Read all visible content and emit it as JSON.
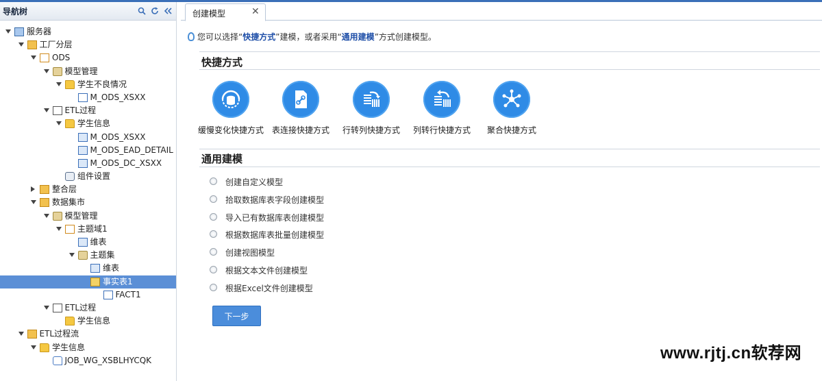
{
  "sidebar": {
    "title": "导航树",
    "tools": [
      "search-icon",
      "refresh-icon",
      "collapse-icon"
    ],
    "tree": [
      {
        "label": "服务器",
        "level": 0,
        "expand": "down",
        "icon": "server-icon"
      },
      {
        "label": "工厂分层",
        "level": 1,
        "expand": "down",
        "icon": "layer-icon"
      },
      {
        "label": "ODS",
        "level": 2,
        "expand": "down",
        "icon": "ods-icon"
      },
      {
        "label": "模型管理",
        "level": 3,
        "expand": "down",
        "icon": "model-manage-icon"
      },
      {
        "label": "学生不良情况",
        "level": 4,
        "expand": "down",
        "icon": "folder-icon"
      },
      {
        "label": "M_ODS_XSXX",
        "level": 5,
        "expand": "",
        "icon": "table-icon"
      },
      {
        "label": "ETL过程",
        "level": 3,
        "expand": "down",
        "icon": "etl-icon"
      },
      {
        "label": "学生信息",
        "level": 4,
        "expand": "down",
        "icon": "folder-icon"
      },
      {
        "label": "M_ODS_XSXX",
        "level": 5,
        "expand": "",
        "icon": "mapping-icon"
      },
      {
        "label": "M_ODS_EAD_DETAIL",
        "level": 5,
        "expand": "",
        "icon": "mapping-icon"
      },
      {
        "label": "M_ODS_DC_XSXX",
        "level": 5,
        "expand": "",
        "icon": "mapping-icon"
      },
      {
        "label": "组件设置",
        "level": 4,
        "expand": "",
        "icon": "component-settings-icon"
      },
      {
        "label": "整合层",
        "level": 2,
        "expand": "right",
        "icon": "layer-icon"
      },
      {
        "label": "数据集市",
        "level": 2,
        "expand": "down",
        "icon": "datamart-icon"
      },
      {
        "label": "模型管理",
        "level": 3,
        "expand": "down",
        "icon": "model-manage-icon"
      },
      {
        "label": "主题域1",
        "level": 4,
        "expand": "down",
        "icon": "subject-domain-icon"
      },
      {
        "label": "维表",
        "level": 5,
        "expand": "",
        "icon": "dimension-icon"
      },
      {
        "label": "主题集",
        "level": 5,
        "expand": "down",
        "icon": "subject-set-icon"
      },
      {
        "label": "维表",
        "level": 6,
        "expand": "",
        "icon": "dimension-icon"
      },
      {
        "label": "事实表1",
        "level": 6,
        "expand": "",
        "icon": "fact-icon",
        "selected": true
      },
      {
        "label": "FACT1",
        "level": 7,
        "expand": "",
        "icon": "table-icon"
      },
      {
        "label": "ETL过程",
        "level": 3,
        "expand": "down",
        "icon": "etl-icon"
      },
      {
        "label": "学生信息",
        "level": 4,
        "expand": "",
        "icon": "folder-icon"
      },
      {
        "label": "ETL过程流",
        "level": 1,
        "expand": "down",
        "icon": "etl-flow-icon"
      },
      {
        "label": "学生信息",
        "level": 2,
        "expand": "down",
        "icon": "folder-icon"
      },
      {
        "label": "JOB_WG_XSBLHYCQK",
        "level": 3,
        "expand": "",
        "icon": "job-icon"
      }
    ]
  },
  "tab": {
    "label": "创建模型",
    "close": "✕"
  },
  "hint": {
    "prefix": "您可以选择“",
    "quick": "快捷方式",
    "middle": "”建模，或者采用“",
    "general": "通用建模",
    "suffix": "”方式创建模型。"
  },
  "quick": {
    "title": "快捷方式",
    "items": [
      {
        "label": "缓慢变化快捷方式",
        "icon": "slowly-changing-icon"
      },
      {
        "label": "表连接快捷方式",
        "icon": "table-join-icon"
      },
      {
        "label": "行转列快捷方式",
        "icon": "row-to-column-icon"
      },
      {
        "label": "列转行快捷方式",
        "icon": "column-to-row-icon"
      },
      {
        "label": "聚合快捷方式",
        "icon": "aggregate-icon"
      }
    ]
  },
  "general": {
    "title": "通用建模",
    "options": [
      "创建自定义模型",
      "拾取数据库表字段创建模型",
      "导入已有数据库表创建模型",
      "根据数据库表批量创建模型",
      "创建视图模型",
      "根据文本文件创建模型",
      "根据Excel文件创建模型"
    ]
  },
  "next_button": "下一步",
  "watermark": "www.rjtj.cn软荐网",
  "colors": {
    "accent": "#2f8be6",
    "selection": "#5b8fd6",
    "button": "#4b8ddb"
  }
}
